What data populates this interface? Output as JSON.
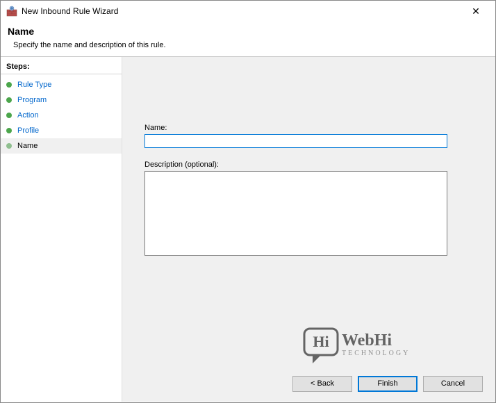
{
  "window": {
    "title": "New Inbound Rule Wizard",
    "close_glyph": "✕"
  },
  "header": {
    "title": "Name",
    "subtitle": "Specify the name and description of this rule."
  },
  "sidebar": {
    "heading": "Steps:",
    "items": [
      {
        "label": "Rule Type",
        "state": "done"
      },
      {
        "label": "Program",
        "state": "done"
      },
      {
        "label": "Action",
        "state": "done"
      },
      {
        "label": "Profile",
        "state": "done"
      },
      {
        "label": "Name",
        "state": "current"
      }
    ]
  },
  "form": {
    "name_label": "Name:",
    "name_value": "",
    "desc_label": "Description (optional):",
    "desc_value": ""
  },
  "buttons": {
    "back": "< Back",
    "finish": "Finish",
    "cancel": "Cancel"
  },
  "watermark": {
    "line1": "WebHi",
    "line2": "TECHNOLOGY",
    "badge": "Hi"
  }
}
